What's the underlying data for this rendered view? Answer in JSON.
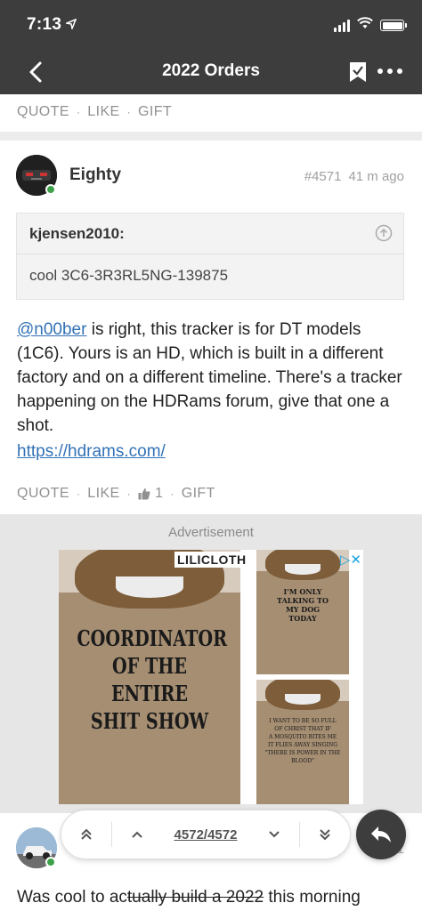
{
  "status": {
    "time": "7:13"
  },
  "nav": {
    "title": "2022 Orders"
  },
  "prev_post_actions": {
    "quote": "QUOTE",
    "like": "LIKE",
    "gift": "GIFT"
  },
  "post": {
    "username": "Eighty",
    "number": "#4571",
    "time_ago": "41 m ago",
    "quote": {
      "author": "kjensen2010:",
      "text": "cool 3C6-3R3RL5NG-139875"
    },
    "mention": "@n00ber",
    "body": " is right, this tracker is for DT models (1C6). Yours is an HD, which is built in a different factory and on a different timeline. There's a tracker happening on the HDRams forum, give that one a shot.",
    "link": "https://hdrams.com/",
    "actions": {
      "quote": "QUOTE",
      "like": "LIKE",
      "like_count": "1",
      "gift": "GIFT"
    }
  },
  "ad": {
    "label": "Advertisement",
    "brand": "LILICLOTH",
    "adchoices": "▷✕",
    "main_print": [
      "COORDINATOR",
      "OF THE ENTIRE",
      "SHIT SHOW"
    ],
    "top_right_print": [
      "I'M ONLY",
      "TALKING TO",
      "MY DOG",
      "TODAY"
    ],
    "bottom_right_print": [
      "I WANT TO BE SO FULL",
      "OF CHRIST THAT IF",
      "A MOSQUITO BITES ME",
      "IT FLIES AWAY SINGING",
      "\"THERE IS POWER IN THE BLOOD\""
    ]
  },
  "pager": {
    "count": "4572/4572"
  },
  "next_post": {
    "time_partial": "11",
    "text_start": "Was cool to ac",
    "text_strike": "tually build a 2022",
    "text_end": " this morning"
  },
  "colors": {
    "header_bg": "#3d3d3d",
    "link": "#3372b6",
    "online": "#3ea14a"
  }
}
